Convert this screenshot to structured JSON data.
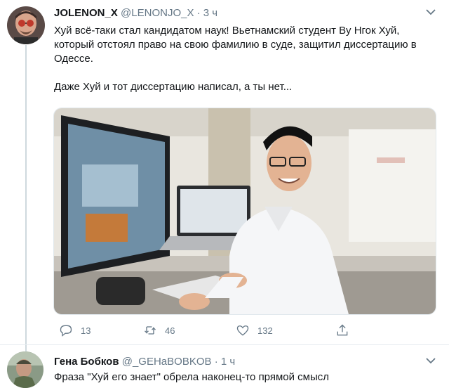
{
  "tweet": {
    "author_name": "JOLENON_X",
    "handle": "@LENONJO_X",
    "separator": "·",
    "time": "3 ч",
    "paragraph1": "Хуй всё-таки стал кандидатом наук! Вьетнамский студент Ву Нгок Хуй, который отстоял право на свою фамилию в суде, защитил диссертацию в Одессе.",
    "paragraph2": "Даже Хуй и тот диссертацию написал, а ты нет...",
    "replies": "13",
    "retweets": "46",
    "likes": "132"
  },
  "reply": {
    "author_name": "Гена Бобков",
    "handle": "@_GEHaBOBKOB",
    "separator": "·",
    "time": "1 ч",
    "text": "Фраза \"Хуй его знает\" обрела наконец-то прямой смысл"
  },
  "icons": [
    "avatar-image",
    "chevron-down-icon",
    "reply-icon",
    "retweet-icon",
    "like-icon",
    "share-icon"
  ],
  "colors": {
    "text": "#14171a",
    "secondary": "#657786",
    "divider": "#e6ecf0"
  }
}
